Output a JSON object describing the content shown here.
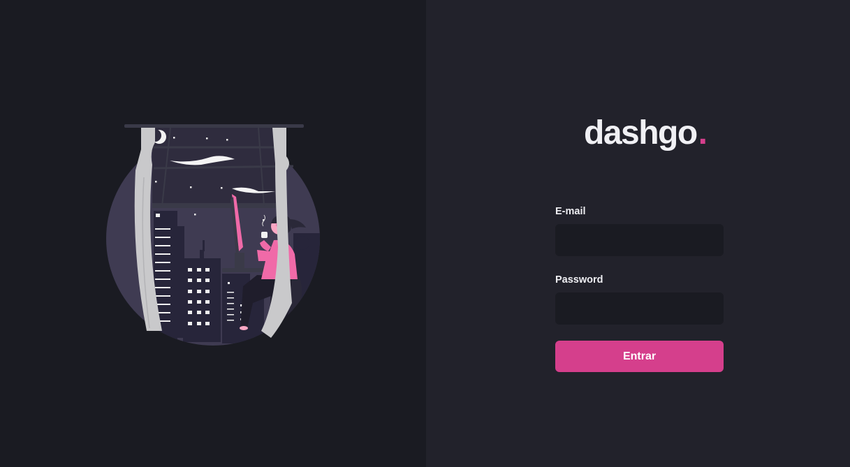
{
  "brand": {
    "name": "dashgo",
    "dot": ".",
    "accent_color": "#d53f8c"
  },
  "illustration": {
    "icon": "woman-at-window-night-city-illustration"
  },
  "form": {
    "email_label": "E-mail",
    "email_value": "",
    "password_label": "Password",
    "password_value": "",
    "submit_label": "Entrar"
  },
  "colors": {
    "left_background": "#1a1b22",
    "right_background": "#22222b",
    "input_background": "#1a1b22",
    "text": "#eeeef2"
  }
}
